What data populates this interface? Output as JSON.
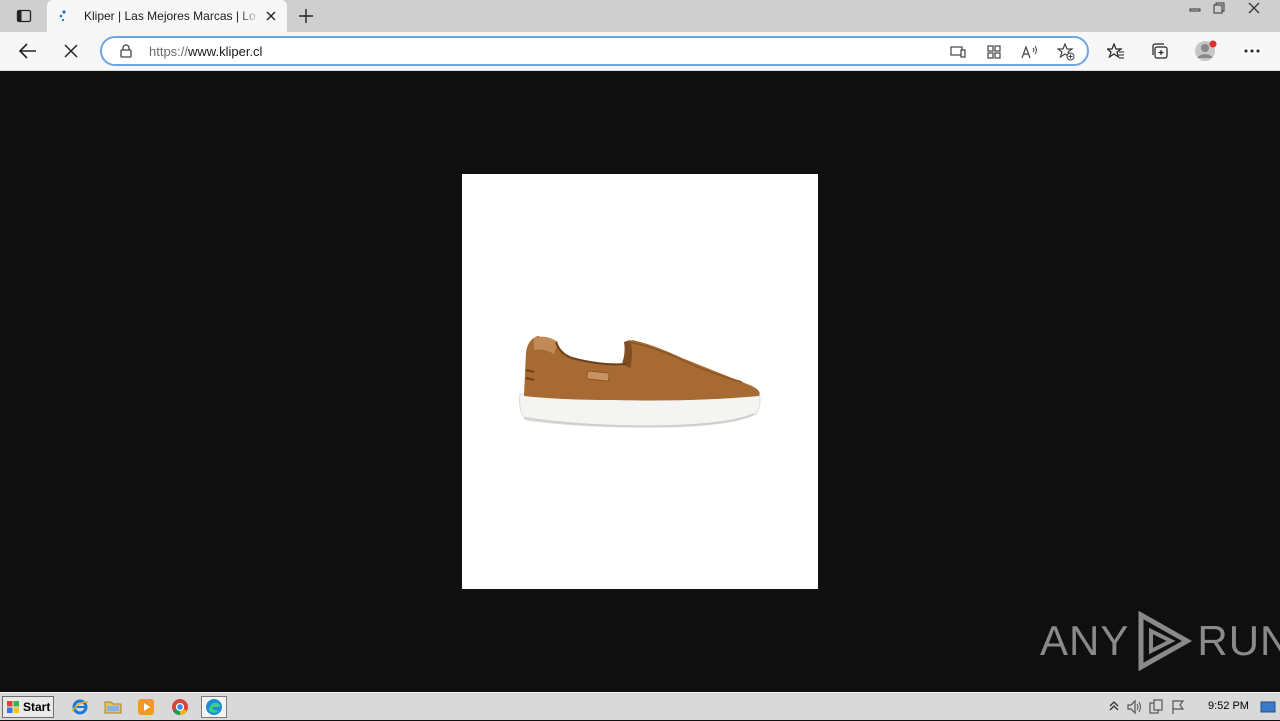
{
  "browser": {
    "tab": {
      "title": "Kliper | Las Mejores Marcas | Lo último en moda"
    },
    "address_bar": {
      "scheme": "https://",
      "host": "www.kliper.cl"
    }
  },
  "watermark": {
    "text": "ANY",
    "text2": "RUN"
  },
  "taskbar": {
    "start_label": "Start",
    "apps": [
      "internet-explorer",
      "file-explorer",
      "media-player",
      "chrome",
      "edge"
    ],
    "clock": "9:52 PM"
  }
}
